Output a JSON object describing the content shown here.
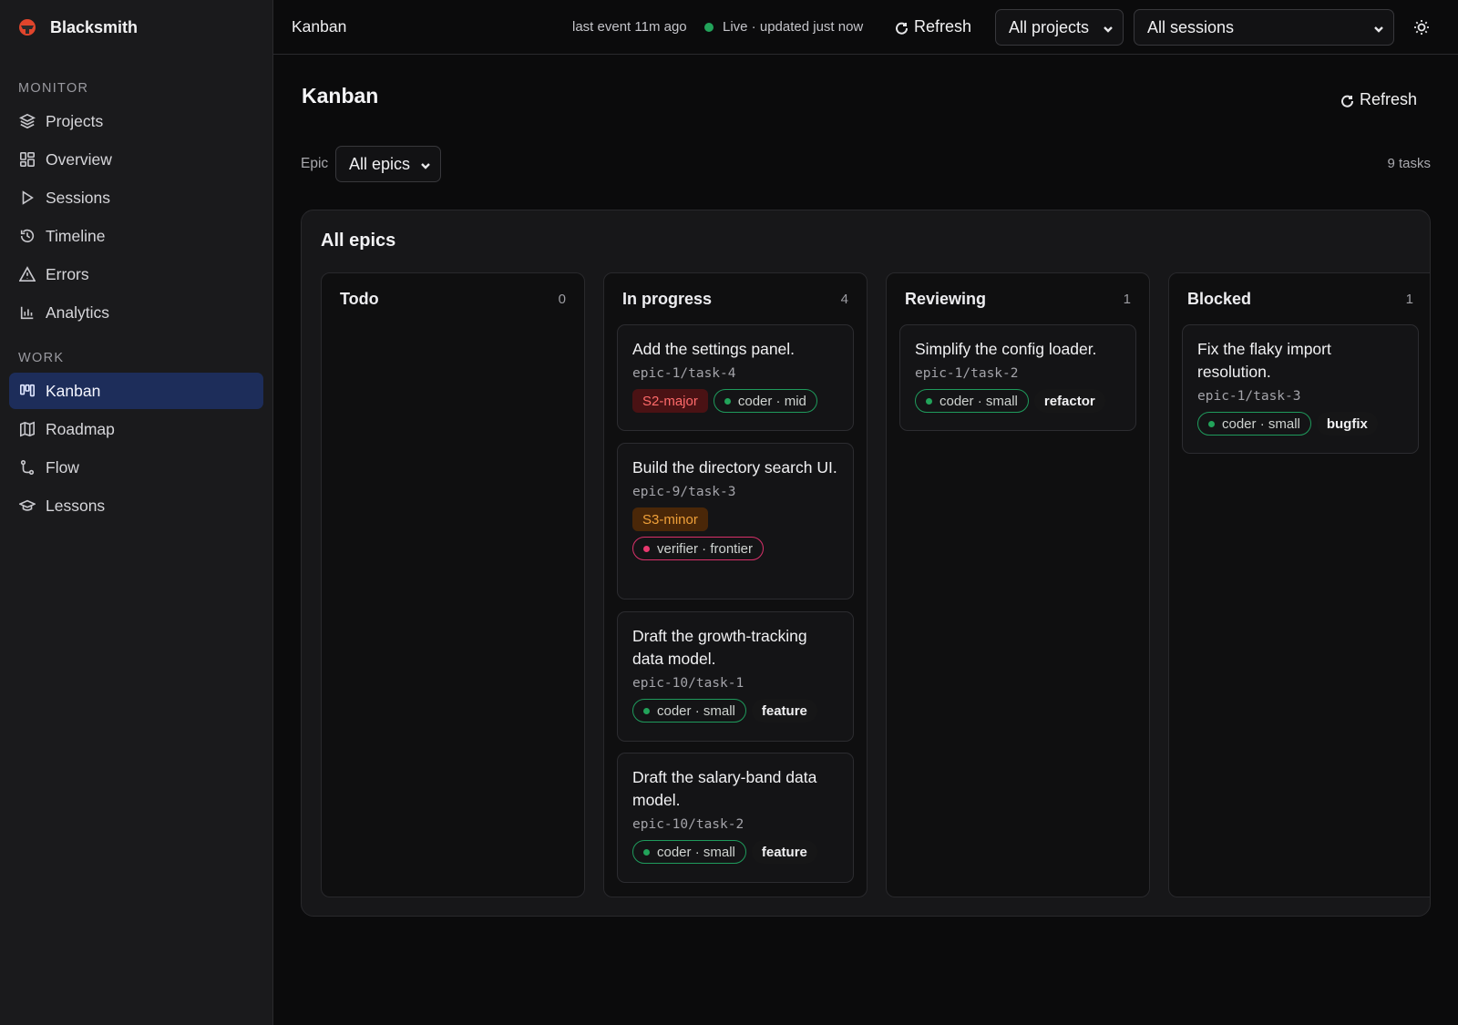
{
  "app": {
    "name": "Blacksmith"
  },
  "sidebar": {
    "sections": [
      {
        "label": "MONITOR",
        "items": [
          {
            "label": "Projects",
            "icon": "layers-icon"
          },
          {
            "label": "Overview",
            "icon": "grid-icon"
          },
          {
            "label": "Sessions",
            "icon": "play-icon"
          },
          {
            "label": "Timeline",
            "icon": "history-icon"
          },
          {
            "label": "Errors",
            "icon": "warning-icon"
          },
          {
            "label": "Analytics",
            "icon": "bar-chart-icon"
          }
        ]
      },
      {
        "label": "WORK",
        "items": [
          {
            "label": "Kanban",
            "icon": "kanban-icon",
            "active": true
          },
          {
            "label": "Roadmap",
            "icon": "map-icon"
          },
          {
            "label": "Flow",
            "icon": "flow-icon"
          },
          {
            "label": "Lessons",
            "icon": "graduation-cap-icon"
          }
        ]
      }
    ]
  },
  "topbar": {
    "title": "Kanban",
    "last_event": "last event 11m ago",
    "live_status": "Live · updated just now",
    "refresh_label": "Refresh",
    "project_select": "All projects",
    "session_select": "All sessions",
    "theme_icon": "sun-icon"
  },
  "main": {
    "title": "Kanban",
    "refresh_label": "Refresh",
    "epic_label": "Epic",
    "epic_select": "All epics",
    "task_count": "9 tasks"
  },
  "board": {
    "title": "All epics",
    "columns": [
      {
        "name": "Todo",
        "count": "0",
        "cards": []
      },
      {
        "name": "In progress",
        "count": "4",
        "cards": [
          {
            "title": "Add the settings panel.",
            "id": "epic-1/task-4",
            "tags": [
              {
                "text": "S2-major",
                "kind": "major"
              },
              {
                "text": "coder · mid",
                "kind": "agent-green"
              }
            ]
          },
          {
            "title": "Build the directory search UI.",
            "id": "epic-9/task-3",
            "tags": [
              {
                "text": "S3-minor",
                "kind": "minor"
              },
              {
                "text": "verifier · frontier",
                "kind": "agent-pink"
              }
            ]
          },
          {
            "title": "Draft the growth-tracking data model.",
            "id": "epic-10/task-1",
            "tags": [
              {
                "text": "coder · small",
                "kind": "agent-green"
              },
              {
                "text": "feature",
                "kind": "plain"
              }
            ]
          },
          {
            "title": "Draft the salary-band data model.",
            "id": "epic-10/task-2",
            "tags": [
              {
                "text": "coder · small",
                "kind": "agent-green"
              },
              {
                "text": "feature",
                "kind": "plain"
              }
            ]
          }
        ]
      },
      {
        "name": "Reviewing",
        "count": "1",
        "cards": [
          {
            "title": "Simplify the config loader.",
            "id": "epic-1/task-2",
            "tags": [
              {
                "text": "coder · small",
                "kind": "agent-green"
              },
              {
                "text": "refactor",
                "kind": "plain"
              }
            ]
          }
        ]
      },
      {
        "name": "Blocked",
        "count": "1",
        "cards": [
          {
            "title": "Fix the flaky import resolution.",
            "id": "epic-1/task-3",
            "tags": [
              {
                "text": "coder · small",
                "kind": "agent-green"
              },
              {
                "text": "bugfix",
                "kind": "plain"
              }
            ]
          }
        ]
      }
    ]
  },
  "colors": {
    "accent_active": "#1d2d5a",
    "live_green": "#22a35a",
    "major_red": "#ff6a6a",
    "minor_orange": "#f0a13a",
    "agent_pink": "#e8396f"
  }
}
